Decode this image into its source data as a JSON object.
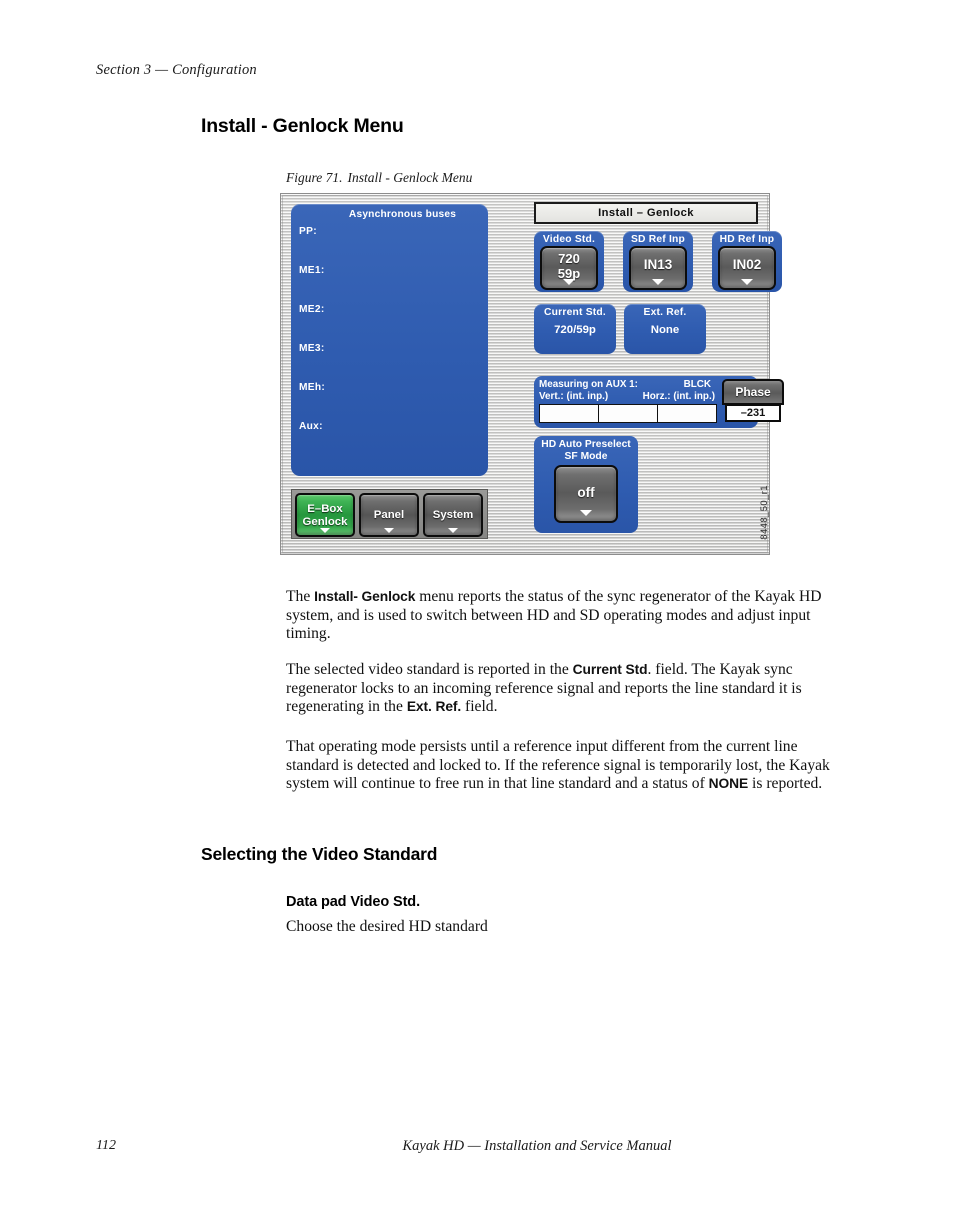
{
  "page": {
    "running_head": "Section 3 — Configuration",
    "folio": "112",
    "footer_title": "Kayak HD  —  Installation and Service Manual"
  },
  "headings": {
    "h1": "Install - Genlock Menu",
    "h2": "Selecting the Video Standard",
    "h3": "Data pad Video Std."
  },
  "figure": {
    "caption_number": "Figure 71.",
    "caption_text": "Install - Genlock Menu",
    "reference_code": "8448_50_r1"
  },
  "device": {
    "title_strip": "Install – Genlock",
    "bus_panel": {
      "title": "Asynchronous buses",
      "labels": [
        "PP:",
        "ME1:",
        "ME2:",
        "ME3:",
        "MEh:",
        "Aux:"
      ]
    },
    "selectors": [
      {
        "label": "Video Std.",
        "value_line1": "720",
        "value_line2": "59p",
        "has_arrow": true
      },
      {
        "label": "SD Ref Inp",
        "value_line1": "IN13",
        "value_line2": "",
        "has_arrow": true
      },
      {
        "label": "HD Ref Inp",
        "value_line1": "IN02",
        "value_line2": "",
        "has_arrow": true
      }
    ],
    "status_tiles": [
      {
        "label": "Current Std.",
        "value": "720/59p"
      },
      {
        "label": "Ext. Ref.",
        "value": "None"
      }
    ],
    "measuring": {
      "title": "Measuring on AUX 1:",
      "source": "BLCK",
      "vert_label": "Vert.:",
      "vert_value": "(int. inp.)",
      "horz_label": "Horz.:",
      "horz_value": "(int. inp.)",
      "field1": "",
      "field2": "",
      "field3": "",
      "phase_label": "Phase",
      "phase_value": "–231"
    },
    "hd_auto_preselect": {
      "line1": "HD Auto Preselect",
      "line2": "SF Mode",
      "button_value": "off"
    },
    "mode_buttons": [
      {
        "line1": "E–Box",
        "line2": "Genlock",
        "active": true
      },
      {
        "line1": "Panel",
        "line2": "",
        "active": false
      },
      {
        "line1": "System",
        "line2": "",
        "active": false
      }
    ],
    "colors": {
      "tile_blue": "#2f5cb0",
      "active_green": "#25973d",
      "button_grey": "#5a5a5a"
    }
  },
  "body": {
    "p1_a": "The ",
    "p1_b": "Install- Genlock",
    "p1_c": " menu reports the status of the sync regenerator of the Kayak HD system, and is used to switch between HD and SD operating modes and adjust input timing.",
    "p2_a": "The selected video standard is reported in the ",
    "p2_b": "Current Std",
    "p2_c": ". field. The Kayak sync regenerator locks to an incoming reference signal and reports the line standard it is regenerating in the ",
    "p2_d": "Ext. Ref.",
    "p2_e": " field.",
    "p3_a": "That operating mode persists until a reference input different from the current line standard is detected and locked to. If the reference signal is temporarily lost, the Kayak system will continue to free run in that line standard and a status of ",
    "p3_b": "NONE",
    "p3_c": " is reported.",
    "p4": "Choose the desired HD standard"
  }
}
